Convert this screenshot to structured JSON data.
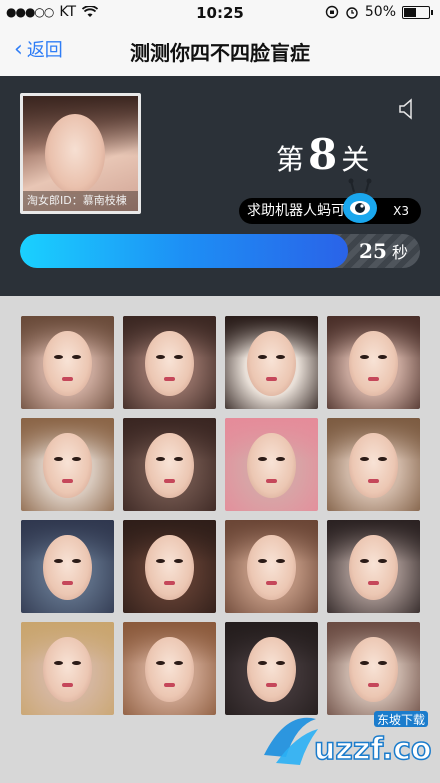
{
  "status": {
    "signal": "●●●○○",
    "carrier": "KT",
    "time": "10:25",
    "battery": "50%"
  },
  "nav": {
    "back_label": "返回",
    "title": "测测你四不四脸盲症"
  },
  "panel": {
    "avatar_caption": "淘女郎ID：慕南枝棟",
    "level_prefix": "第",
    "level_number": "8",
    "level_suffix": "关",
    "help_label": "求助机器人蚂可",
    "help_count": "X3",
    "timer_seconds": "25",
    "timer_unit": "秒",
    "timer_progress": 0.82
  },
  "grid": {
    "tiles": [
      {
        "bg": "#c9a79a",
        "hair": "#6a4b3a"
      },
      {
        "bg": "#8d6b62",
        "hair": "#3b2722"
      },
      {
        "bg": "#e9e0d8",
        "hair": "#2a1d1a"
      },
      {
        "bg": "#c7a69b",
        "hair": "#4a2f29"
      },
      {
        "bg": "#d8c9bd",
        "hair": "#8b6547"
      },
      {
        "bg": "#6a5048",
        "hair": "#3a2622"
      },
      {
        "bg": "#d8a4a6",
        "hair": "#e58c9a"
      },
      {
        "bg": "#cfb7a6",
        "hair": "#7d5c42"
      },
      {
        "bg": "#5b6b83",
        "hair": "#30384f"
      },
      {
        "bg": "#5a3a2f",
        "hair": "#2f1e19"
      },
      {
        "bg": "#b9907b",
        "hair": "#6b4636"
      },
      {
        "bg": "#9a8a86",
        "hair": "#2b2222"
      },
      {
        "bg": "#d5b69e",
        "hair": "#c9a56e"
      },
      {
        "bg": "#c9a08a",
        "hair": "#8b5a3c"
      },
      {
        "bg": "#3f3537",
        "hair": "#241d1d"
      },
      {
        "bg": "#c8b3a8",
        "hair": "#6b4c43"
      }
    ]
  },
  "watermark": {
    "text": "uzzf.com",
    "sub": "东坡下载"
  }
}
